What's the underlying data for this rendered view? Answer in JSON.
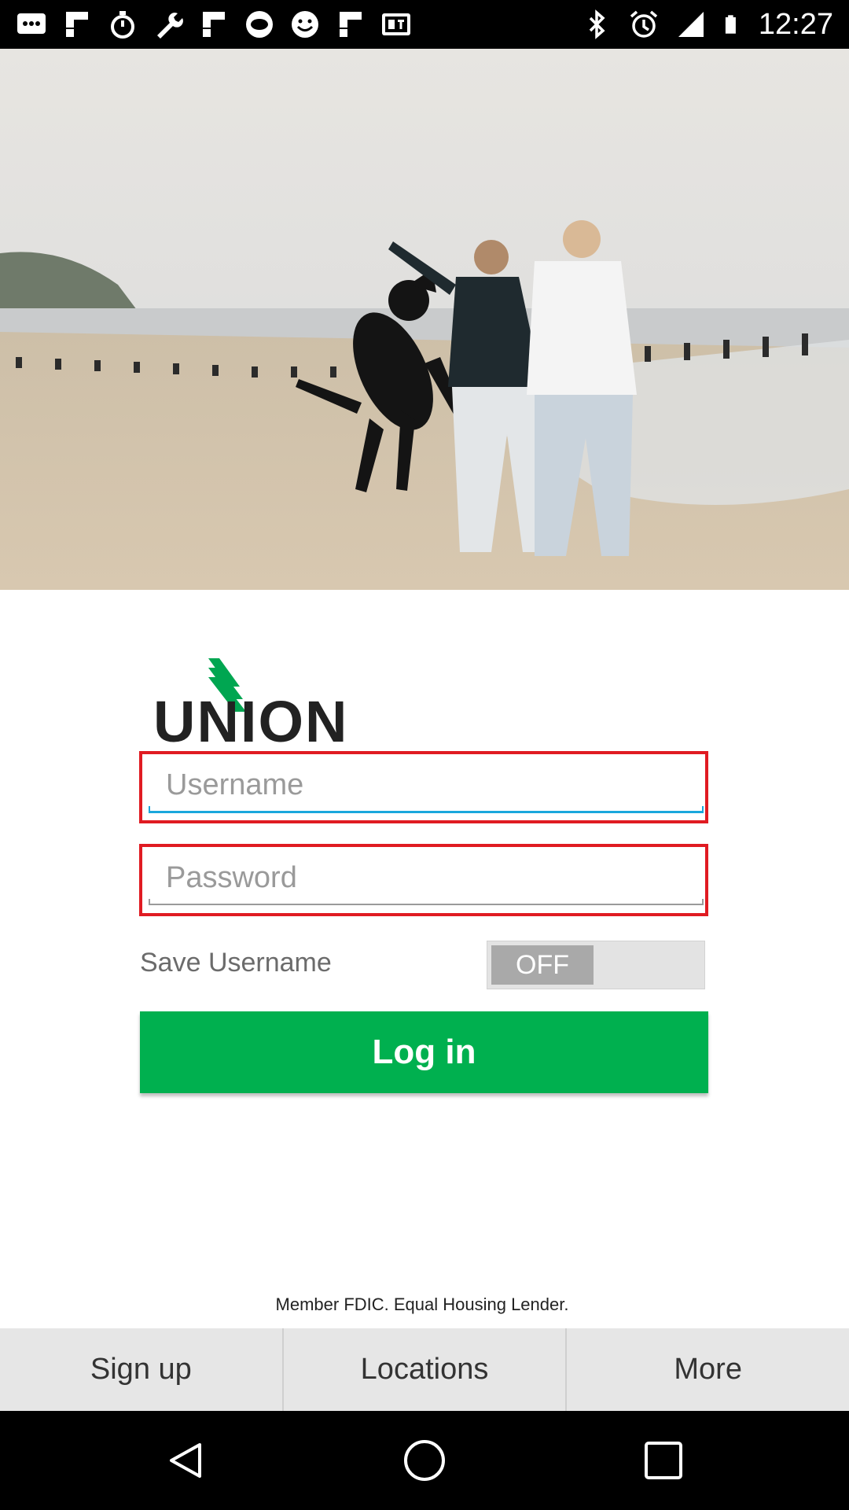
{
  "status_bar": {
    "time": "12:27",
    "left_icons": [
      "message-icon",
      "flipboard-icon",
      "stopwatch-icon",
      "wrench-icon",
      "flipboard-icon",
      "fox-sports-icon",
      "smiley-icon",
      "flipboard-icon",
      "qt-icon"
    ],
    "right_icons": [
      "bluetooth-icon",
      "alarm-icon",
      "signal-icon",
      "battery-icon"
    ]
  },
  "hero": {
    "image_desc": "beach-couple-dog-photo"
  },
  "logo": {
    "brand_colors": {
      "dark": "#222222",
      "green": "#00a651"
    }
  },
  "login": {
    "username_placeholder": "Username",
    "password_placeholder": "Password",
    "save_username_label": "Save Username",
    "save_username_state": "OFF",
    "login_button": "Log in"
  },
  "footer": {
    "disclaimer": "Member FDIC. Equal Housing Lender."
  },
  "tabs": [
    {
      "label": "Sign up"
    },
    {
      "label": "Locations"
    },
    {
      "label": "More"
    }
  ],
  "nav": {
    "buttons": [
      "back-icon",
      "home-icon",
      "recents-icon"
    ]
  },
  "colors": {
    "field_border": "#e01b22",
    "focus_underline": "#1aa7dc",
    "login_bg": "#00b04f",
    "tabbar_bg": "#e6e6e6"
  }
}
